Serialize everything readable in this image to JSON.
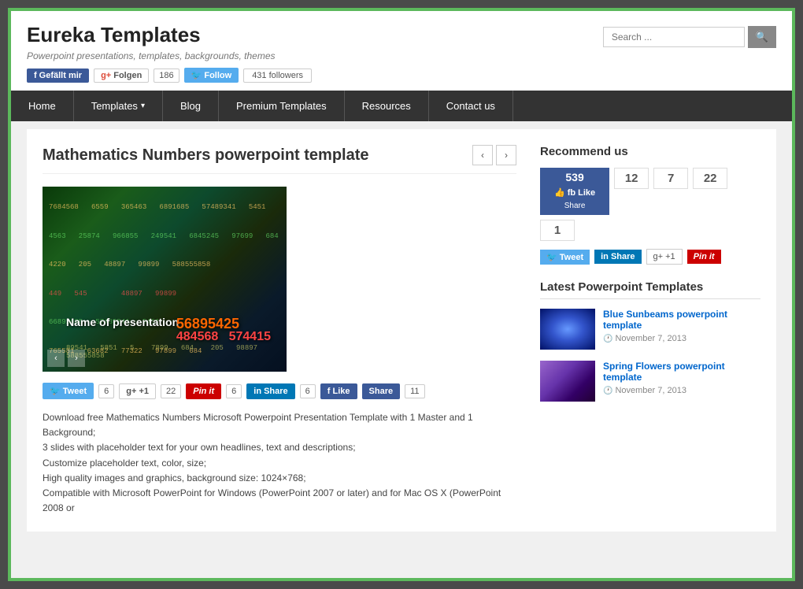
{
  "site": {
    "title": "Eureka Templates",
    "tagline": "Powerpoint presentations, templates, backgrounds, themes",
    "outer_border_color": "#5cb85c"
  },
  "social": {
    "fb_label": "Gefällt mir",
    "gp_label": "Folgen",
    "gp_count": "186",
    "tw_label": "Follow",
    "tw_count": "431 followers"
  },
  "search": {
    "placeholder": "Search ...",
    "icon": "🔍"
  },
  "nav": {
    "items": [
      {
        "label": "Home"
      },
      {
        "label": "Templates",
        "has_arrow": true
      },
      {
        "label": "Blog"
      },
      {
        "label": "Premium Templates"
      },
      {
        "label": "Resources"
      },
      {
        "label": "Contact us"
      }
    ]
  },
  "article": {
    "title": "Mathematics Numbers powerpoint template",
    "slide": {
      "number_rows": [
        "7684568  6559  365463  6891685  57489341  5451",
        "4563  25874  966855  249541  6845245  97699  684",
        "4220  205  48897  99899  588555858",
        "449  545",
        "66891685  57489541  5451",
        "765581  63682  77322  97899  684",
        "Name of presentation",
        "56895425",
        "484568  574415",
        "89541  5851  5",
        "7899  684",
        "205  98897  99899  588555858"
      ],
      "title_text": "Name of presentation",
      "highlight_text": "56895425"
    },
    "share": {
      "tweet_count": "6",
      "gplus_count": "22",
      "pin_count": "6",
      "linkedin_count": "6",
      "like_count": "11"
    },
    "description_lines": [
      "Download free Mathematics Numbers Microsoft Powerpoint Presentation Template with 1 Master and 1 Background;",
      "3 slides with placeholder text for your own headlines, text and descriptions;",
      "Customize placeholder text, color, size;",
      "High quality images and graphics, background size: 1024×768;",
      "Compatible with Microsoft PowerPoint for Windows (PowerPoint 2007 or later) and for Mac OS X (PowerPoint 2008 or"
    ]
  },
  "sidebar": {
    "recommend": {
      "title": "Recommend us",
      "fb_count": "539",
      "tw_count": "12",
      "li_count": "7",
      "gp_count": "22",
      "pin_count": "1"
    },
    "latest": {
      "title": "Latest Powerpoint Templates",
      "items": [
        {
          "name": "Blue Sunbeams powerpoint template",
          "date": "November 7, 2013",
          "thumb_class": "thumb-blue"
        },
        {
          "name": "Spring Flowers powerpoint template",
          "date": "November 7, 2013",
          "thumb_class": "thumb-purple"
        }
      ]
    }
  }
}
